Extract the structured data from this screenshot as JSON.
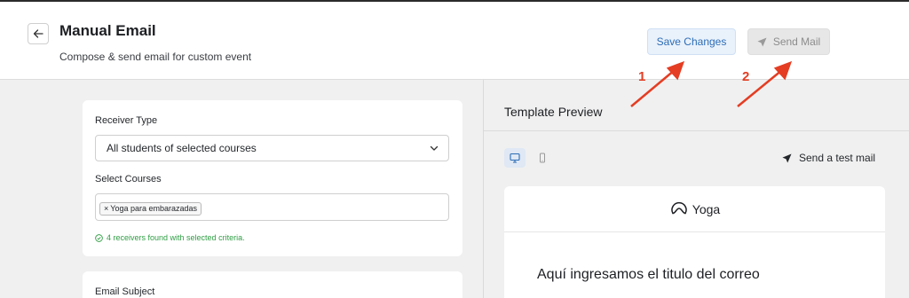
{
  "header": {
    "title": "Manual Email",
    "subtitle": "Compose & send email for custom event",
    "save_label": "Save Changes",
    "send_label": "Send Mail"
  },
  "annotations": [
    "1",
    "2"
  ],
  "receiver_form": {
    "receiver_type_label": "Receiver Type",
    "receiver_type_value": "All students of selected courses",
    "select_courses_label": "Select Courses",
    "selected_courses": [
      "Yoga para embarazadas"
    ],
    "chip_remove": "×",
    "found_text": "4 receivers found with selected criteria."
  },
  "email_form": {
    "subject_label": "Email Subject"
  },
  "preview": {
    "title": "Template Preview",
    "test_mail_label": "Send a test mail",
    "logo_text": "Yoga",
    "heading": "Aquí ingresamos el titulo del correo"
  },
  "colors": {
    "accent": "#2d6db6",
    "annotation": "#e43d23",
    "success": "#2f9e44"
  }
}
